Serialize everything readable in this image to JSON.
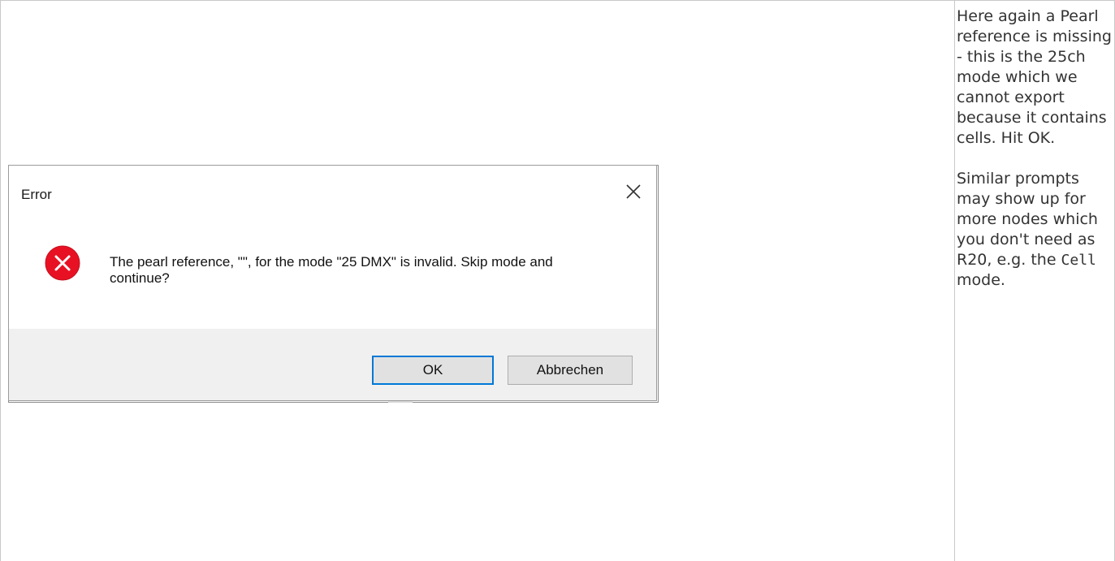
{
  "dialog": {
    "title": "Error",
    "message": "The pearl reference, \"\", for the mode \"25 DMX\" is invalid. Skip mode and continue?",
    "ok_label": "OK",
    "cancel_label": "Abbrechen",
    "icon": "error-icon",
    "close_icon": "close-icon",
    "accent_color": "#0078d7",
    "error_color": "#e81123"
  },
  "note": {
    "paragraph1": "Here again a Pearl reference is missing - this is the 25ch mode which we cannot export because it contains cells. Hit OK.",
    "paragraph2_prefix": "Similar prompts may show up for more nodes which you don't need as R20, e.g. the ",
    "paragraph2_code": "Cell",
    "paragraph2_suffix": " mode."
  }
}
